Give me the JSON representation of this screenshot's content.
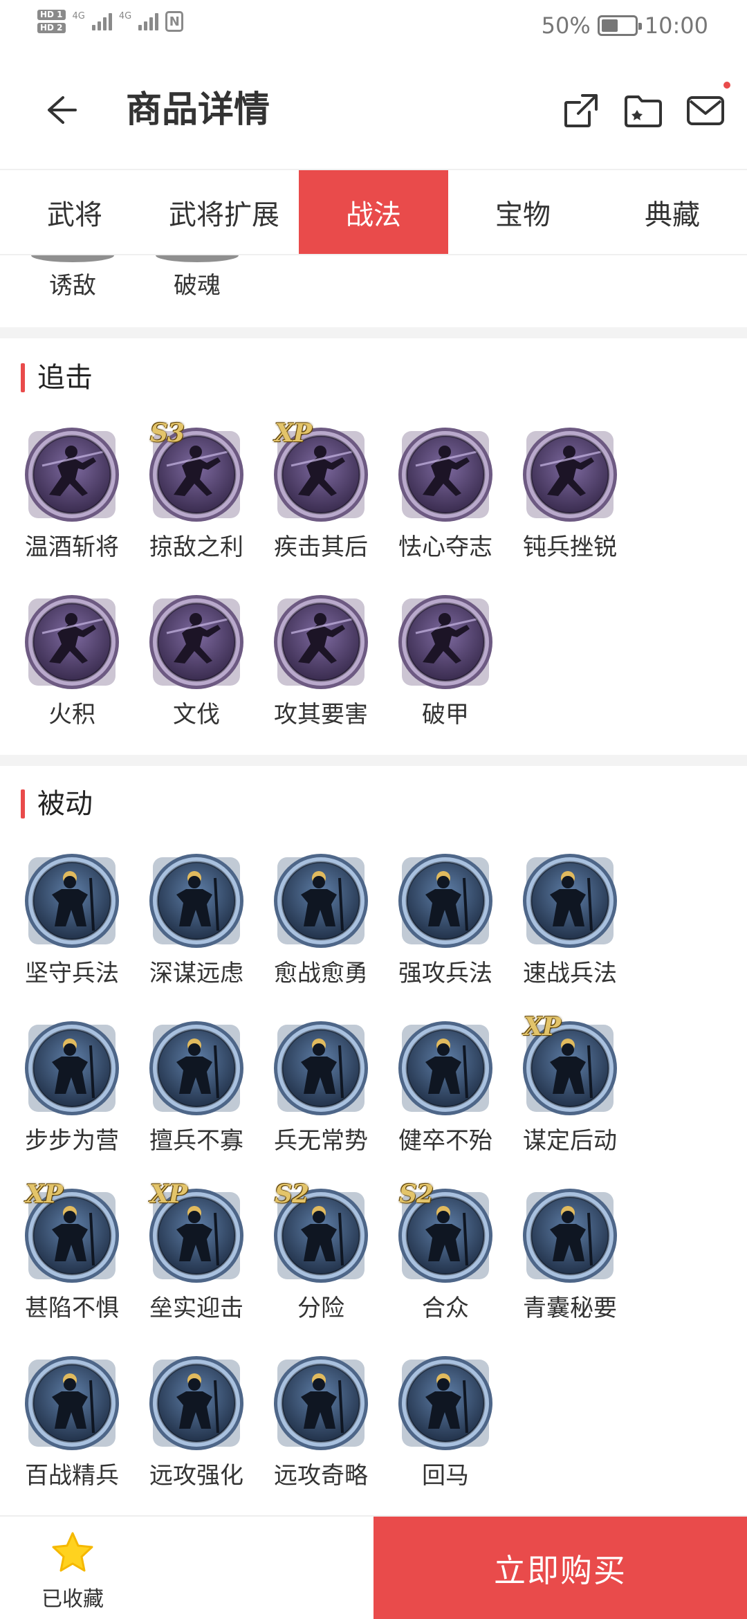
{
  "status_bar": {
    "hd1": "HD 1",
    "hd2": "HD 2",
    "net1": "4G",
    "net2": "4G",
    "nfc": "N",
    "battery_percent": "50%",
    "battery_level": 0.5,
    "time": "10:00"
  },
  "header": {
    "title": "商品详情",
    "back_icon": "arrow-left-icon",
    "share_icon": "share-icon",
    "folder_icon": "folder-star-icon",
    "mail_icon": "mail-icon",
    "mail_has_notification": true
  },
  "tabs": [
    {
      "label": "武将",
      "active": false
    },
    {
      "label": "武将扩展",
      "active": false
    },
    {
      "label": "战法",
      "active": true
    },
    {
      "label": "宝物",
      "active": false
    },
    {
      "label": "典藏",
      "active": false
    }
  ],
  "partial_section": {
    "items": [
      {
        "label": "诱敌"
      },
      {
        "label": "破魂"
      }
    ]
  },
  "sections": [
    {
      "title": "追击",
      "style": "pursuit",
      "items": [
        {
          "label": "温酒斩将",
          "badge": ""
        },
        {
          "label": "掠敌之利",
          "badge": "S3"
        },
        {
          "label": "疾击其后",
          "badge": "XP"
        },
        {
          "label": "怯心夺志",
          "badge": ""
        },
        {
          "label": "钝兵挫锐",
          "badge": ""
        },
        {
          "label": "火积",
          "badge": ""
        },
        {
          "label": "文伐",
          "badge": ""
        },
        {
          "label": "攻其要害",
          "badge": ""
        },
        {
          "label": "破甲",
          "badge": ""
        }
      ]
    },
    {
      "title": "被动",
      "style": "passive",
      "items": [
        {
          "label": "坚守兵法",
          "badge": ""
        },
        {
          "label": "深谋远虑",
          "badge": ""
        },
        {
          "label": "愈战愈勇",
          "badge": ""
        },
        {
          "label": "强攻兵法",
          "badge": ""
        },
        {
          "label": "速战兵法",
          "badge": ""
        },
        {
          "label": "步步为营",
          "badge": ""
        },
        {
          "label": "擅兵不寡",
          "badge": ""
        },
        {
          "label": "兵无常势",
          "badge": ""
        },
        {
          "label": "健卒不殆",
          "badge": ""
        },
        {
          "label": "谋定后动",
          "badge": "XP"
        },
        {
          "label": "甚陷不惧",
          "badge": "XP"
        },
        {
          "label": "垒实迎击",
          "badge": "XP"
        },
        {
          "label": "分险",
          "badge": "S2"
        },
        {
          "label": "合众",
          "badge": "S2"
        },
        {
          "label": "青囊秘要",
          "badge": ""
        },
        {
          "label": "百战精兵",
          "badge": ""
        },
        {
          "label": "远攻强化",
          "badge": ""
        },
        {
          "label": "远攻奇略",
          "badge": ""
        },
        {
          "label": "回马",
          "badge": ""
        }
      ]
    }
  ],
  "bottom_bar": {
    "favorite_label": "已收藏",
    "favorite_icon": "star-icon",
    "buy_label": "立即购买"
  },
  "colors": {
    "accent": "#e94b4b",
    "star": "#ffd21f",
    "pursuit_icon": "#6a4f86",
    "passive_icon": "#4d6a92"
  }
}
